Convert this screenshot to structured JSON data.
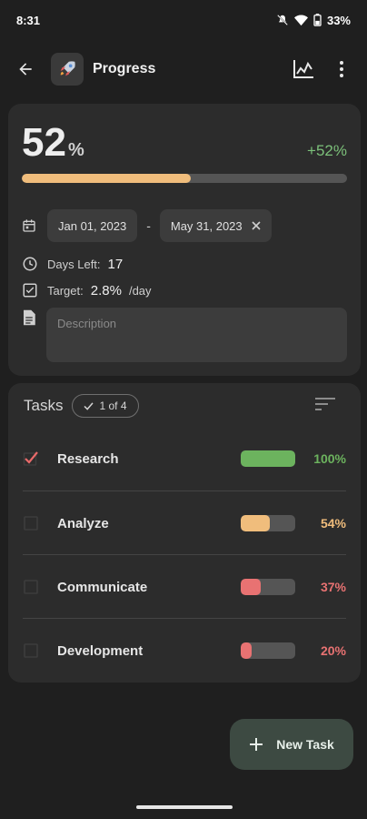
{
  "status_bar": {
    "time": "8:31",
    "battery": "33%"
  },
  "app_bar": {
    "title": "Progress"
  },
  "progress": {
    "percent": "52",
    "percent_sign": "%",
    "delta": "+52%",
    "fill_fraction": 0.52,
    "fill_color": "#f0bd7c"
  },
  "dates": {
    "start": "Jan 01, 2023",
    "separator": "-",
    "end": "May 31, 2023"
  },
  "days_left": {
    "label": "Days Left:",
    "value": "17"
  },
  "target": {
    "label": "Target:",
    "value": "2.8%",
    "unit": "/day"
  },
  "description": {
    "placeholder": "Description"
  },
  "tasks": {
    "title": "Tasks",
    "count": "1 of 4",
    "items": [
      {
        "name": "Research",
        "percent": "100%",
        "fraction": 1.0,
        "color": "#6cb35e",
        "checked": true
      },
      {
        "name": "Analyze",
        "percent": "54%",
        "fraction": 0.54,
        "color": "#f0bd7c",
        "checked": false
      },
      {
        "name": "Communicate",
        "percent": "37%",
        "fraction": 0.37,
        "color": "#e87272",
        "checked": false
      },
      {
        "name": "Development",
        "percent": "20%",
        "fraction": 0.2,
        "color": "#e87272",
        "checked": false
      }
    ]
  },
  "fab": {
    "label": "New Task"
  },
  "colors": {
    "accent_green": "#7cc07a",
    "check_red": "#e96a6a"
  }
}
